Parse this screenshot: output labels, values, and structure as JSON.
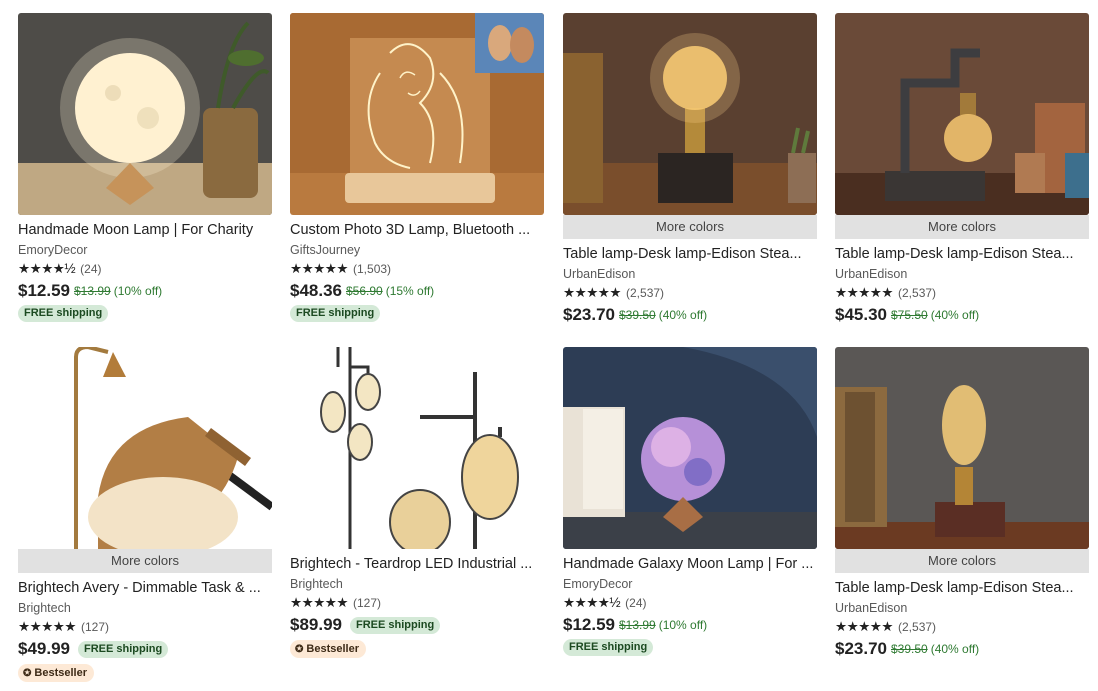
{
  "listings": [
    {
      "title": "Handmade Moon Lamp | For Charity",
      "shop": "EmoryDecor",
      "stars": "★★★★½",
      "reviews": "(24)",
      "price": "$12.59",
      "original_price": "$13.99",
      "discount": "(10% off)",
      "free_shipping": "FREE shipping",
      "more_colors": null,
      "bestseller": null
    },
    {
      "title": "Custom Photo 3D Lamp, Bluetooth ...",
      "shop": "GiftsJourney",
      "stars": "★★★★★",
      "reviews": "(1,503)",
      "price": "$48.36",
      "original_price": "$56.90",
      "discount": "(15% off)",
      "free_shipping": "FREE shipping",
      "more_colors": null,
      "bestseller": null
    },
    {
      "title": "Table lamp-Desk lamp-Edison Stea...",
      "shop": "UrbanEdison",
      "stars": "★★★★★",
      "reviews": "(2,537)",
      "price": "$23.70",
      "original_price": "$39.50",
      "discount": "(40% off)",
      "free_shipping": null,
      "more_colors": "More colors",
      "bestseller": null
    },
    {
      "title": "Table lamp-Desk lamp-Edison Stea...",
      "shop": "UrbanEdison",
      "stars": "★★★★★",
      "reviews": "(2,537)",
      "price": "$45.30",
      "original_price": "$75.50",
      "discount": "(40% off)",
      "free_shipping": null,
      "more_colors": "More colors",
      "bestseller": null
    },
    {
      "title": "Brightech Avery - Dimmable Task & ...",
      "shop": "Brightech",
      "stars": "★★★★★",
      "reviews": "(127)",
      "price": "$49.99",
      "original_price": null,
      "discount": null,
      "free_shipping": "FREE shipping",
      "more_colors": "More colors",
      "bestseller": "Bestseller"
    },
    {
      "title": "Brightech - Teardrop LED Industrial ...",
      "shop": "Brightech",
      "stars": "★★★★★",
      "reviews": "(127)",
      "price": "$89.99",
      "original_price": null,
      "discount": null,
      "free_shipping": "FREE shipping",
      "more_colors": null,
      "bestseller": "Bestseller"
    },
    {
      "title": "Handmade Galaxy Moon Lamp | For ...",
      "shop": "EmoryDecor",
      "stars": "★★★★½",
      "reviews": "(24)",
      "price": "$12.59",
      "original_price": "$13.99",
      "discount": "(10% off)",
      "free_shipping": "FREE shipping",
      "more_colors": null,
      "bestseller": null
    },
    {
      "title": "Table lamp-Desk lamp-Edison Stea...",
      "shop": "UrbanEdison",
      "stars": "★★★★★",
      "reviews": "(2,537)",
      "price": "$23.70",
      "original_price": "$39.50",
      "discount": "(40% off)",
      "free_shipping": null,
      "more_colors": "More colors",
      "bestseller": null
    }
  ],
  "colors": {
    "price_green": "#2f7a32",
    "ship_badge_bg": "#d4e9d7",
    "bestseller_bg": "#fde9d6",
    "more_colors_bg": "#e1e1e1"
  },
  "icons": {
    "bestseller": "award-ribbon-icon",
    "rating": "star-icon"
  }
}
